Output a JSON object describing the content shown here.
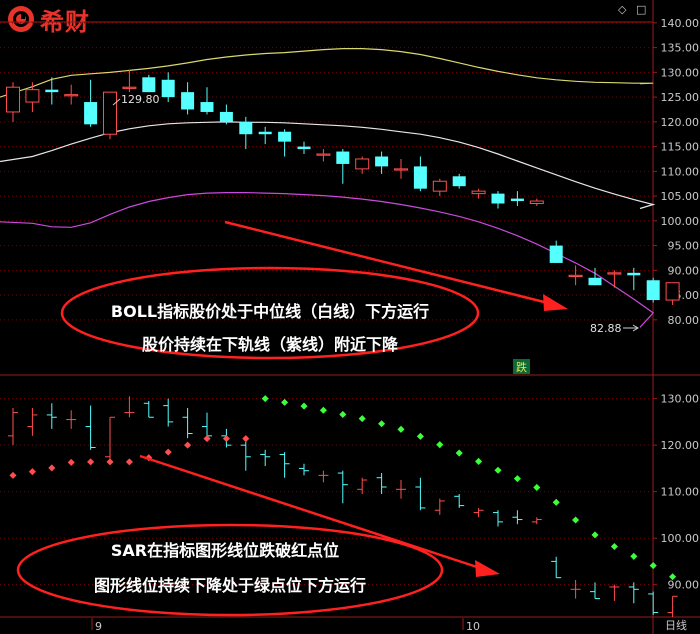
{
  "brand": {
    "name": "希财"
  },
  "header_icons": {
    "diamond": "diamond-icon",
    "square": "square-icon"
  },
  "colors": {
    "background": "#000000",
    "axis": "#9a1b1b",
    "grid": "#7a0000",
    "axis_text": "#c9c9c9",
    "bull": "#ff4e4e",
    "bear": "#55ffff",
    "boll_upper": "#d8d86e",
    "boll_mid": "#e6e6e6",
    "boll_lower": "#c84bdc",
    "sar_red": "#ff4e4e",
    "sar_green": "#3cff3c",
    "annotation": "#ff2020",
    "annotation_text": "#ffffff",
    "tag_bg": "#0c6a36",
    "tag_text": "#f2e24a"
  },
  "annotations": {
    "boll": {
      "line1": "BOLL指标股价处于中位线（白线）下方运行",
      "line2": "股价持续在下轨线（紫线）附近下降"
    },
    "sar": {
      "line1": "SAR在指标图形线位跌破红点位",
      "line2": "图形线位持续下降处于绿点位下方运行"
    }
  },
  "labels": {
    "high_price": "129.80",
    "last_price": "82.88",
    "fall_tag": "跌",
    "period": "日线",
    "date_ticks": [
      "9",
      "10"
    ]
  },
  "chart_data": [
    {
      "type": "candlestick",
      "panel": "price",
      "indicator": "BOLL",
      "ylim": [
        77,
        143
      ],
      "y_ticks": [
        80,
        85,
        90,
        95,
        100,
        105,
        110,
        115,
        120,
        125,
        130,
        135,
        140
      ],
      "ohlc": [
        [
          122,
          128,
          120,
          127
        ],
        [
          124,
          128,
          122,
          126.5
        ],
        [
          126.5,
          129,
          123.5,
          126
        ],
        [
          125.5,
          127.5,
          123.5,
          125.5
        ],
        [
          124,
          128.5,
          119,
          119.5
        ],
        [
          117.5,
          126,
          116.5,
          126
        ],
        [
          127,
          130.5,
          126,
          127
        ],
        [
          129,
          129.5,
          126,
          126
        ],
        [
          128.5,
          130,
          124,
          125
        ],
        [
          126,
          128,
          121.5,
          122.5
        ],
        [
          124,
          127,
          121.5,
          122
        ],
        [
          122,
          123.5,
          119.5,
          120
        ],
        [
          120,
          121,
          114.5,
          117.5
        ],
        [
          118,
          119,
          115.5,
          117.5
        ],
        [
          118,
          118.5,
          113,
          116
        ],
        [
          115,
          116,
          113.5,
          114.5
        ],
        [
          113.5,
          114.5,
          112,
          113.5
        ],
        [
          114,
          114.5,
          107.5,
          111.5
        ],
        [
          110.5,
          113,
          109.5,
          112.5
        ],
        [
          113,
          114,
          109.5,
          111
        ],
        [
          110.5,
          112.5,
          108.5,
          110.5
        ],
        [
          111,
          113,
          106,
          106.5
        ],
        [
          106,
          108.5,
          105,
          108
        ],
        [
          109,
          109.5,
          106.5,
          107
        ],
        [
          105.5,
          106.5,
          104.5,
          106
        ],
        [
          105.5,
          106,
          102.5,
          103.5
        ],
        [
          104.5,
          106,
          103,
          104
        ],
        [
          103.5,
          104.5,
          103,
          104
        ],
        [
          95,
          96,
          91.5,
          91.5
        ],
        [
          89,
          91,
          87,
          89
        ],
        [
          88.5,
          90.5,
          87,
          87
        ],
        [
          89.5,
          90,
          86.5,
          89.5
        ],
        [
          89.5,
          90.5,
          86,
          89
        ],
        [
          88,
          88.5,
          83.5,
          84
        ],
        [
          84,
          87.5,
          83,
          87.5
        ]
      ],
      "series": [
        {
          "name": "upper",
          "values": [
            125,
            127.1,
            128.6,
            129.4,
            129.7,
            130,
            130.4,
            130.8,
            131.3,
            131.9,
            132.6,
            133.1,
            133.5,
            133.8,
            134,
            134.3,
            134.6,
            134.8,
            134.8,
            134.6,
            134.2,
            133.6,
            132.8,
            131.9,
            131,
            130.2,
            129.5,
            128.9,
            128.5,
            128.2,
            128,
            127.9,
            127.8,
            127.8,
            127.7
          ]
        },
        {
          "name": "mid",
          "values": [
            112,
            113,
            114.2,
            115.5,
            116.7,
            117.8,
            118.6,
            119.2,
            119.6,
            119.8,
            119.9,
            120,
            119.9,
            119.9,
            119.8,
            119.6,
            119.4,
            119.2,
            118.9,
            118.5,
            118,
            117.5,
            116.8,
            115.9,
            114.8,
            113.5,
            112.1,
            110.7,
            109.3,
            107.9,
            106.6,
            105.4,
            104.3,
            103.3,
            102.5
          ]
        },
        {
          "name": "lower",
          "values": [
            99.8,
            99.5,
            98.8,
            98.7,
            99.6,
            101.3,
            102.8,
            103.9,
            104.7,
            105.3,
            105.6,
            105.7,
            105.7,
            105.6,
            105.5,
            105.3,
            105.1,
            104.8,
            104.4,
            103.9,
            103.3,
            102.6,
            101.8,
            100.9,
            99.8,
            98.5,
            97,
            95.3,
            93.4,
            91.5,
            89.4,
            86.8,
            84.2,
            81.4,
            78.5
          ]
        }
      ]
    },
    {
      "type": "candlestick",
      "panel": "indicator",
      "indicator": "SAR",
      "ylim": [
        85,
        133
      ],
      "y_ticks": [
        90,
        100,
        110,
        120,
        130
      ],
      "sar_points": [
        {
          "i": 0,
          "value": 113.5,
          "color": "red"
        },
        {
          "i": 1,
          "value": 114.3,
          "color": "red"
        },
        {
          "i": 2,
          "value": 115.1,
          "color": "red"
        },
        {
          "i": 3,
          "value": 116.3,
          "color": "red"
        },
        {
          "i": 4,
          "value": 116.4,
          "color": "red"
        },
        {
          "i": 5,
          "value": 116.4,
          "color": "red"
        },
        {
          "i": 6,
          "value": 116.4,
          "color": "red"
        },
        {
          "i": 7,
          "value": 117.3,
          "color": "red"
        },
        {
          "i": 8,
          "value": 118.5,
          "color": "red"
        },
        {
          "i": 9,
          "value": 120,
          "color": "red"
        },
        {
          "i": 10,
          "value": 121.4,
          "color": "red"
        },
        {
          "i": 11,
          "value": 121.4,
          "color": "red"
        },
        {
          "i": 12,
          "value": 121.4,
          "color": "red"
        },
        {
          "i": 13,
          "value": 130,
          "color": "green"
        },
        {
          "i": 14,
          "value": 129.2,
          "color": "green"
        },
        {
          "i": 15,
          "value": 128.4,
          "color": "green"
        },
        {
          "i": 16,
          "value": 127.5,
          "color": "green"
        },
        {
          "i": 17,
          "value": 126.6,
          "color": "green"
        },
        {
          "i": 18,
          "value": 125.7,
          "color": "green"
        },
        {
          "i": 19,
          "value": 124.6,
          "color": "green"
        },
        {
          "i": 20,
          "value": 123.4,
          "color": "green"
        },
        {
          "i": 21,
          "value": 121.9,
          "color": "green"
        },
        {
          "i": 22,
          "value": 120.1,
          "color": "green"
        },
        {
          "i": 23,
          "value": 118.3,
          "color": "green"
        },
        {
          "i": 24,
          "value": 116.5,
          "color": "green"
        },
        {
          "i": 25,
          "value": 114.6,
          "color": "green"
        },
        {
          "i": 26,
          "value": 112.8,
          "color": "green"
        },
        {
          "i": 27,
          "value": 110.9,
          "color": "green"
        },
        {
          "i": 28,
          "value": 107.7,
          "color": "green"
        },
        {
          "i": 29,
          "value": 103.9,
          "color": "green"
        },
        {
          "i": 30,
          "value": 100.7,
          "color": "green"
        },
        {
          "i": 31,
          "value": 98.2,
          "color": "green"
        },
        {
          "i": 32,
          "value": 96.1,
          "color": "green"
        },
        {
          "i": 33,
          "value": 94.1,
          "color": "green"
        },
        {
          "i": 34,
          "value": 91.7,
          "color": "green"
        }
      ]
    }
  ]
}
